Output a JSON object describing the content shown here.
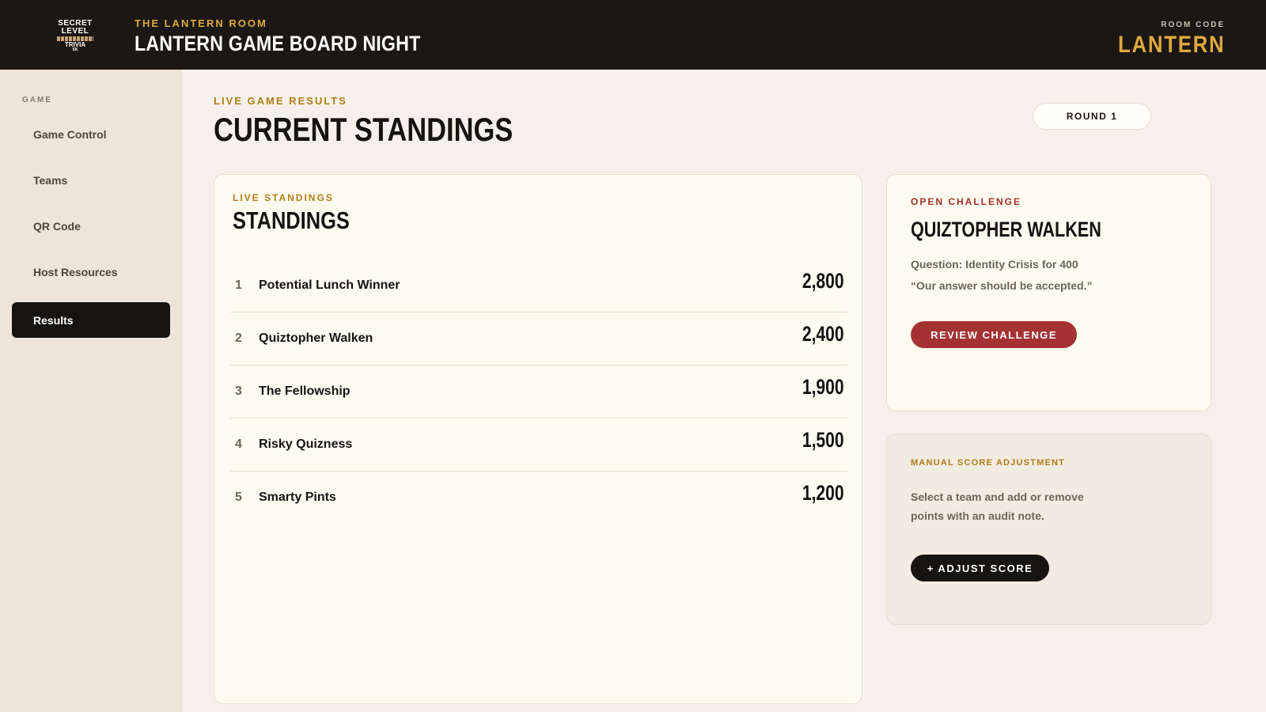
{
  "header": {
    "logo_line1": "SECRET",
    "logo_line2": "LEVEL",
    "logo_line3": "TRIVIA",
    "logo_line4": "SK",
    "kicker": "THE LANTERN ROOM",
    "title": "LANTERN GAME BOARD NIGHT",
    "room_label": "ROOM CODE",
    "room_code": "LANTERN"
  },
  "sidebar": {
    "heading": "GAME",
    "items": [
      {
        "label": "Game Control",
        "active": false
      },
      {
        "label": "Teams",
        "active": false
      },
      {
        "label": "QR Code",
        "active": false
      },
      {
        "label": "Host Resources",
        "active": false
      },
      {
        "label": "Results",
        "active": true
      }
    ]
  },
  "main": {
    "kicker": "LIVE GAME RESULTS",
    "title": "CURRENT STANDINGS",
    "round": "ROUND 1"
  },
  "standings": {
    "kicker": "LIVE STANDINGS",
    "title": "STANDINGS",
    "rows": [
      {
        "rank": "1",
        "team": "Potential Lunch Winner",
        "score": "2,800"
      },
      {
        "rank": "2",
        "team": "Quiztopher Walken",
        "score": "2,400"
      },
      {
        "rank": "3",
        "team": "The Fellowship",
        "score": "1,900"
      },
      {
        "rank": "4",
        "team": "Risky Quizness",
        "score": "1,500"
      },
      {
        "rank": "5",
        "team": "Smarty Pints",
        "score": "1,200"
      }
    ]
  },
  "challenge": {
    "kicker": "OPEN CHALLENGE",
    "team": "QUIZTOPHER WALKEN",
    "question": "Question: Identity Crisis for 400",
    "quote": "“Our answer should be accepted.”",
    "button": "REVIEW CHALLENGE"
  },
  "adjustment": {
    "kicker": "MANUAL SCORE ADJUSTMENT",
    "description": "Select a team and add or remove points with an audit note.",
    "button": "+ ADJUST SCORE"
  },
  "colors": {
    "accent_gold": "#e0a83e",
    "kicker_gold": "#b07d17",
    "challenge_red": "#a53232",
    "dark": "#161411"
  }
}
